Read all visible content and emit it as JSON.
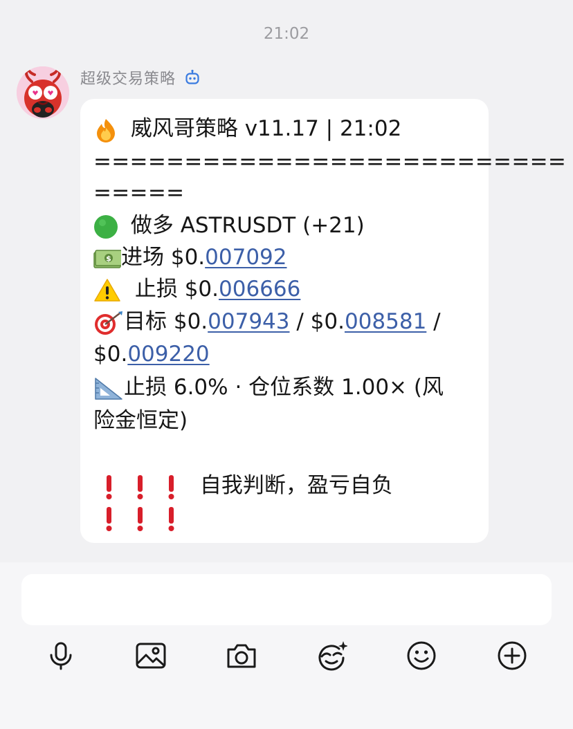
{
  "chat": {
    "timestamp": "21:02"
  },
  "message": {
    "sender": "超级交易策略",
    "sender_badge_icon": "bot-icon",
    "title": {
      "emoji_icon": "fire-icon",
      "text": "威风哥策略 v11.17 | 21:02"
    },
    "divider_line1": "==========================",
    "divider_line2": "=====",
    "direction": {
      "emoji_icon": "green-circle-icon",
      "text": "做多 ASTRUSDT (+21)"
    },
    "entry": {
      "emoji_icon": "money-icon",
      "label": "进场 $0.",
      "value": "007092"
    },
    "stop": {
      "emoji_icon": "warning-icon",
      "label": "止损 $0.",
      "value": "006666"
    },
    "targets": {
      "emoji_icon": "target-icon",
      "label": "目标 $0.",
      "t1": "007943",
      "sep1": " / $0.",
      "t2": "008581",
      "sep2": " /",
      "t3_prefix": "$0.",
      "t3": "009220"
    },
    "risk": {
      "emoji_icon": "triangle-ruler-icon",
      "line1": "止损 6.0% · 仓位系数 1.00× (风",
      "line2": "险金恒定)"
    },
    "disclaimer": {
      "emoji_icon": "exclamation-icon",
      "text": "自我判断，盈亏自负"
    }
  },
  "composer": {
    "input_value": "",
    "toolbar": [
      "microphone-icon",
      "image-icon",
      "camera-icon",
      "sticker-icon",
      "emoji-icon",
      "add-icon"
    ]
  }
}
